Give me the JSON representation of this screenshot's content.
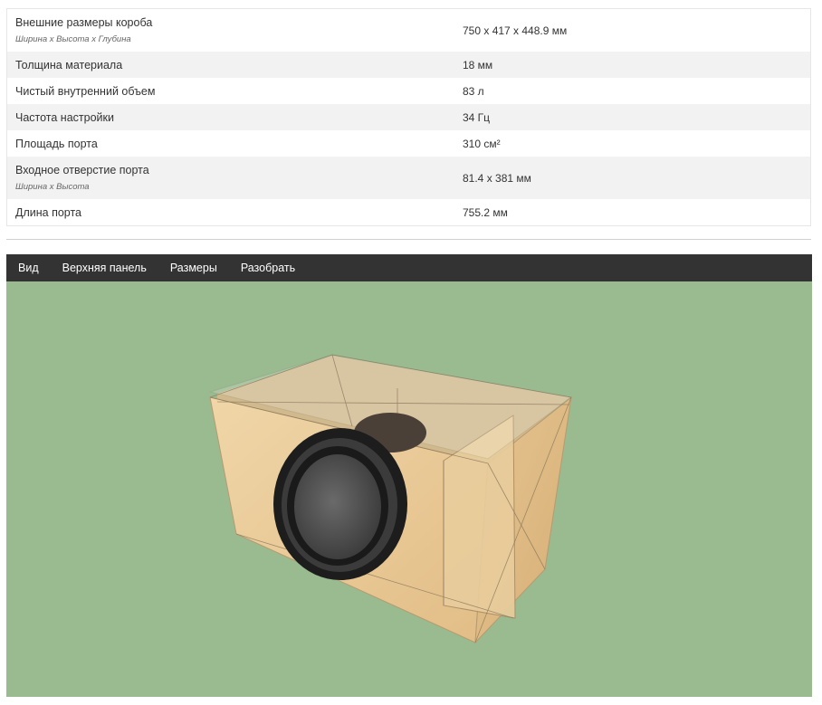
{
  "specs": [
    {
      "label": "Внешние размеры короба",
      "sublabel": "Ширина x Высота x Глубина",
      "value": "750 x 417 x 448.9 мм"
    },
    {
      "label": "Толщина материала",
      "value": "18 мм"
    },
    {
      "label": "Чистый внутренний объем",
      "value": "83 л"
    },
    {
      "label": "Частота настройки",
      "value": "34 Гц"
    },
    {
      "label": "Площадь порта",
      "value": "310 см²"
    },
    {
      "label": "Входное отверстие порта",
      "sublabel": "Ширина x Высота",
      "value": "81.4 x 381 мм"
    },
    {
      "label": "Длина порта",
      "value": "755.2 мм"
    }
  ],
  "toolbar": {
    "view": "Вид",
    "top_panel": "Верхняя панель",
    "dimensions": "Размеры",
    "disassemble": "Разобрать"
  },
  "colors": {
    "viewport_bg": "#9aba8f",
    "toolbar_bg": "#333333",
    "wood": "#e8c898",
    "speaker": "#2a2a2a"
  }
}
